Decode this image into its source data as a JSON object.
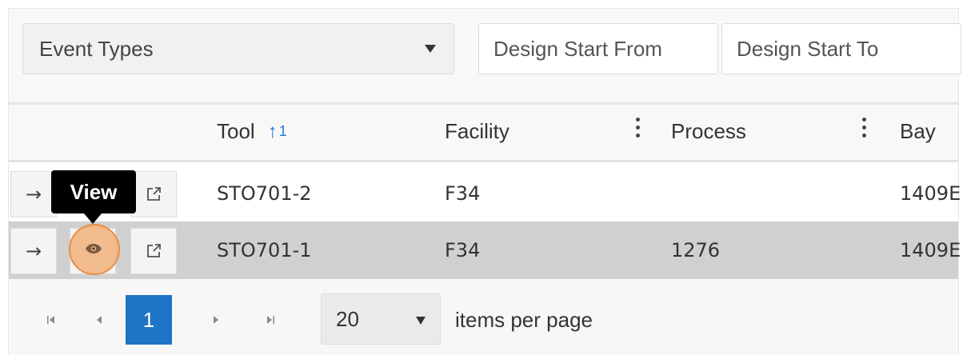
{
  "filters": {
    "event_types": "Event Types",
    "design_start_from": "Design Start From",
    "design_start_to": "Design Start To"
  },
  "columns": {
    "tool": "Tool",
    "sort_order": "1",
    "facility": "Facility",
    "process": "Process",
    "bay": "Bay"
  },
  "rows": [
    {
      "tool": "STO701-2",
      "facility": "F34",
      "process": "",
      "bay": "1409E"
    },
    {
      "tool": "STO701-1",
      "facility": "F34",
      "process": "1276",
      "bay": "1409E"
    }
  ],
  "tooltip": {
    "text": "View"
  },
  "pager": {
    "current_page": "1",
    "page_size": "20",
    "items_per_page_label": "items per page"
  },
  "icons": {
    "go": "arrow-right-icon",
    "view": "eye-icon",
    "open": "external-link-icon",
    "sort": "sort-ascending-icon",
    "first": "first-page-icon",
    "prev": "previous-page-icon",
    "next": "next-page-icon",
    "last": "last-page-icon"
  },
  "colors": {
    "accent": "#1f74c6",
    "selected_row": "#d0d0d0",
    "tooltip_bg": "#000000",
    "highlight": "#f2b27b"
  }
}
